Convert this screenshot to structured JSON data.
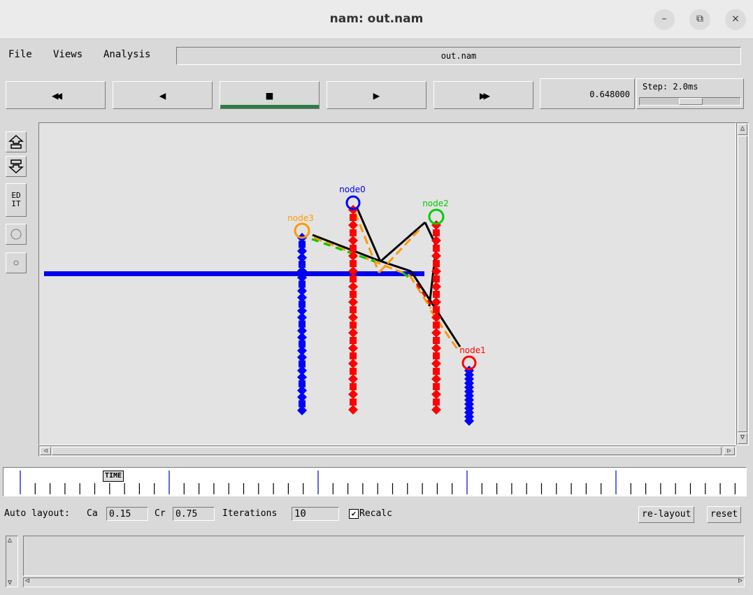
{
  "window": {
    "title": "nam: out.nam",
    "minimize_glyph": "–",
    "restore_glyph": "⧉",
    "close_glyph": "×"
  },
  "menu": {
    "file": "File",
    "views": "Views",
    "analysis": "Analysis",
    "file_name": "out.nam"
  },
  "controls": {
    "rewind_glyph": "◀◀",
    "back_glyph": "◀",
    "stop_glyph": "■",
    "play_glyph": "▶",
    "fastforward_glyph": "▶▶",
    "current_time": "0.648000",
    "step_label": "Step: 2.0ms",
    "step_slider_fraction": 0.5,
    "active_indicator_color": "#2e7d46"
  },
  "tools": {
    "edit_label": "ED IT"
  },
  "network": {
    "nodes": [
      {
        "id": "node0",
        "color": "#0000ff"
      },
      {
        "id": "node1",
        "color": "#ff0000"
      },
      {
        "id": "node2",
        "color": "#00cc00"
      },
      {
        "id": "node3",
        "color": "#ff9900"
      }
    ],
    "packet_colors": [
      "#ff0000",
      "#0000ff"
    ],
    "link_color": "#000000"
  },
  "timeline": {
    "time_label": "TIME",
    "major_tick_color": "#0000cc"
  },
  "auto_layout": {
    "label": "Auto layout:",
    "ca_label": "Ca",
    "ca_value": "0.15",
    "cr_label": "Cr",
    "cr_value": "0.75",
    "iterations_label": "Iterations",
    "iterations_value": "10",
    "recalc_label": "Recalc",
    "recalc_checked": true,
    "relayout_button": "re-layout",
    "reset_button": "reset"
  }
}
